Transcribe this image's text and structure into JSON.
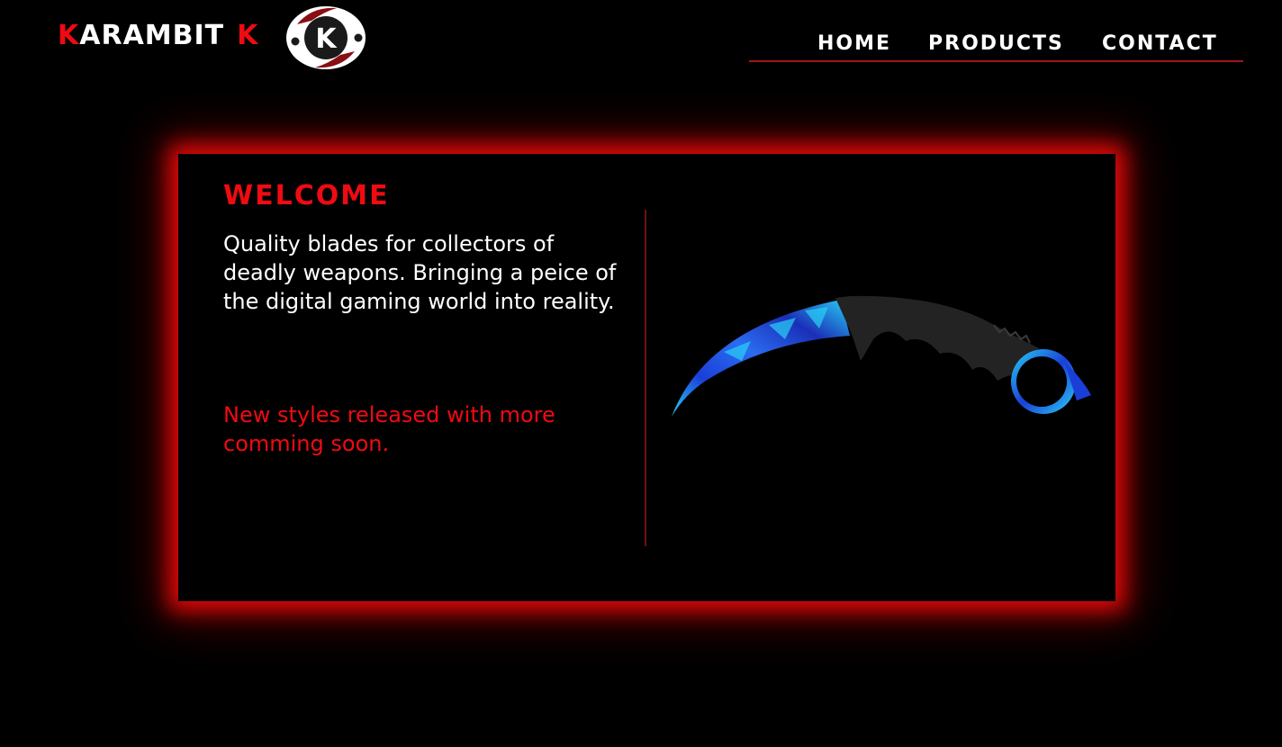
{
  "brand": {
    "letter_first": "K",
    "word": "ARAMBIT",
    "letter_last": "K"
  },
  "logo": {
    "letter": "K",
    "icon": "karambit-k-emblem-icon"
  },
  "nav": {
    "items": [
      {
        "label": "HOME"
      },
      {
        "label": "PRODUCTS"
      },
      {
        "label": "CONTACT"
      }
    ]
  },
  "welcome": {
    "title": "WELCOME",
    "intro": "Quality blades for collectors of deadly weapons. Bringing a peice of the digital gaming world into reality.",
    "note": "New styles released with more comming soon."
  },
  "product_image": {
    "icon": "karambit-knife-image"
  },
  "colors": {
    "accent_red": "#f00a12",
    "text_white": "#ffffff",
    "background": "#000000",
    "divider": "#6e0f12",
    "blade_blue": "#1a3fd8",
    "blade_cyan": "#29d2f5",
    "handle_gray": "#232323"
  }
}
